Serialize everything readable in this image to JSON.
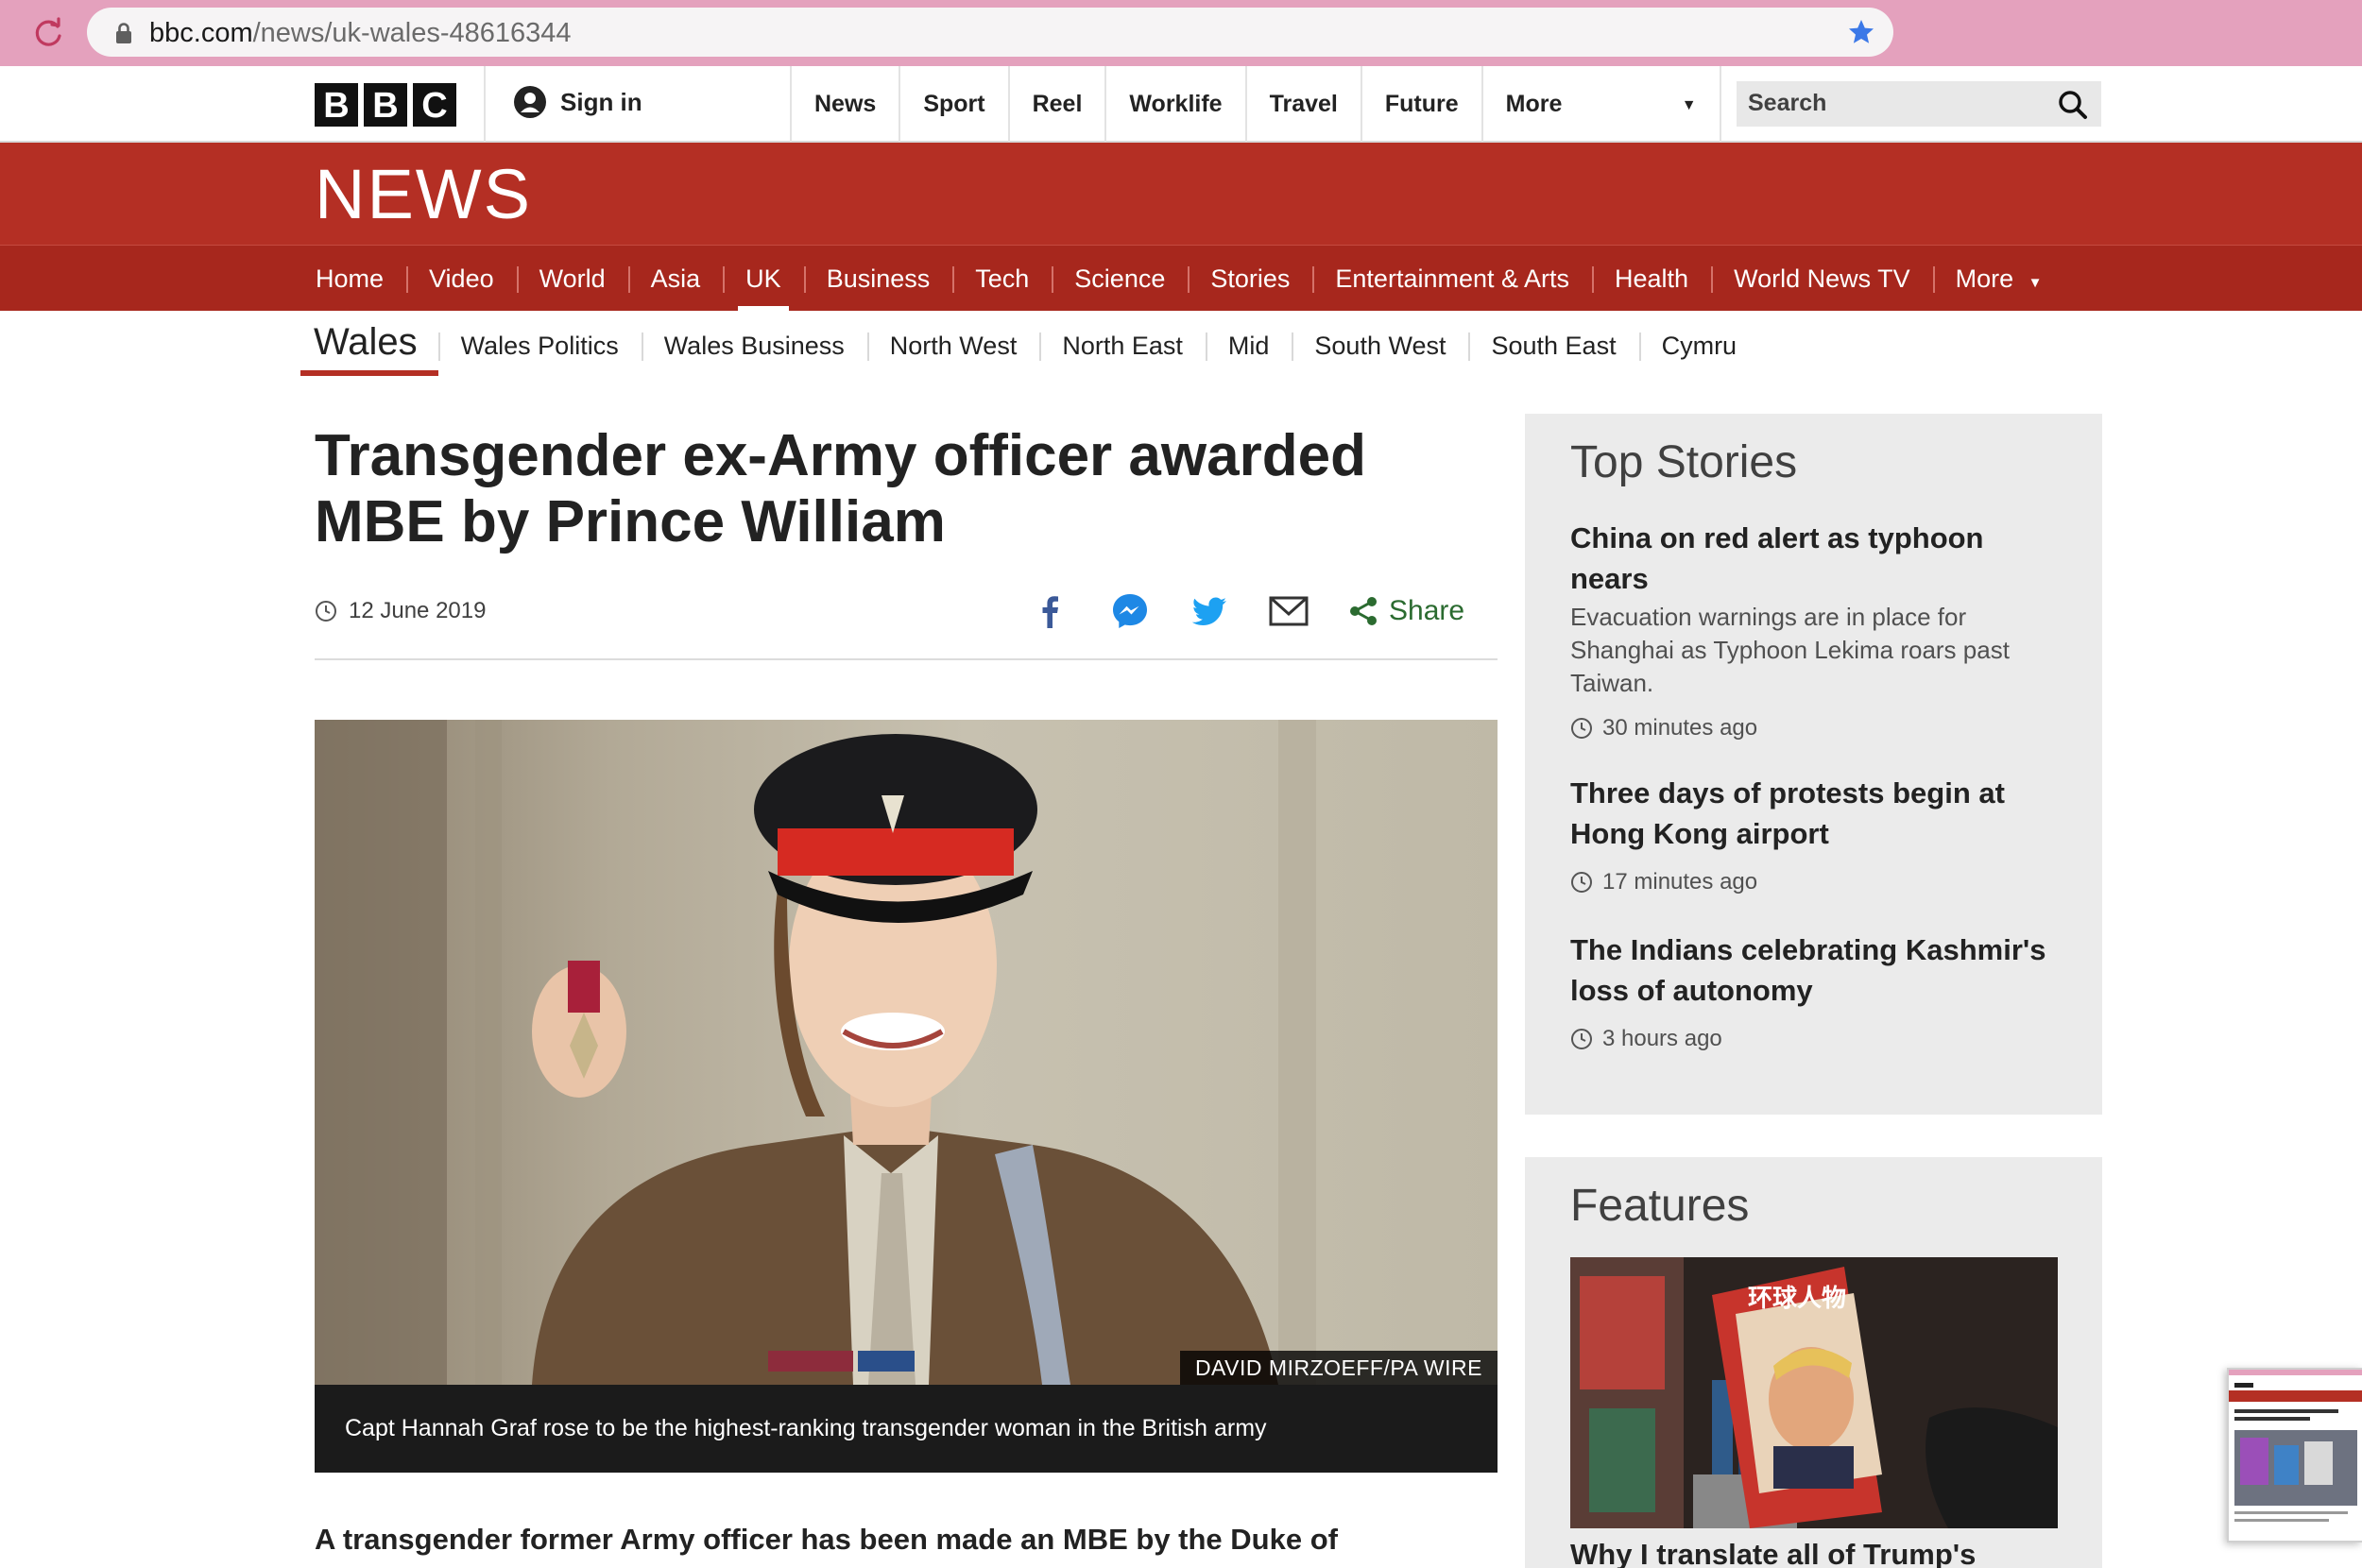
{
  "browser": {
    "url_host": "bbc.com",
    "url_path": "/news/uk-wales-48616344"
  },
  "global_nav": {
    "logo": [
      "B",
      "B",
      "C"
    ],
    "sign_in": "Sign in",
    "items": [
      "News",
      "Sport",
      "Reel",
      "Worklife",
      "Travel",
      "Future"
    ],
    "more": "More",
    "search_placeholder": "Search"
  },
  "masthead": {
    "title": "NEWS"
  },
  "section_nav": {
    "items": [
      "Home",
      "Video",
      "World",
      "Asia",
      "UK",
      "Business",
      "Tech",
      "Science",
      "Stories",
      "Entertainment & Arts",
      "Health",
      "World News TV"
    ],
    "more": "More",
    "active": "UK"
  },
  "wales_nav": {
    "title": "Wales",
    "items": [
      "Wales Politics",
      "Wales Business",
      "North West",
      "North East",
      "Mid",
      "South West",
      "South East",
      "Cymru"
    ]
  },
  "article": {
    "headline_line1": "Transgender ex-Army officer awarded",
    "headline_line2": "MBE by Prince William",
    "date": "12 June 2019",
    "share_label": "Share",
    "image_credit": "DAVID MIRZOEFF/PA WIRE",
    "caption": "Capt Hannah Graf rose to be the highest-ranking transgender woman in the British army",
    "intro": "A transgender former Army officer has been made an MBE by the Duke of"
  },
  "top_stories": {
    "title": "Top Stories",
    "stories": [
      {
        "title_line1": "China on red alert as typhoon",
        "title_line2": "nears",
        "summary_line1": "Evacuation warnings are in place for",
        "summary_line2": "Shanghai as Typhoon Lekima roars past",
        "summary_line3": "Taiwan.",
        "time": "30 minutes ago"
      },
      {
        "title_line1": "Three days of protests begin at",
        "title_line2": "Hong Kong airport",
        "time": "17 minutes ago"
      },
      {
        "title_line1": "The Indians celebrating Kashmir's",
        "title_line2": "loss of autonomy",
        "time": "3 hours ago"
      }
    ]
  },
  "features": {
    "title": "Features",
    "magazine_text": "环球人物",
    "story_title": "Why I translate all of Trump's"
  },
  "colors": {
    "bbc_red": "#b42f24",
    "bbc_red_dark": "#a7271d",
    "share_green": "#2b6b30",
    "chrome_pink": "#e4a1bd"
  }
}
